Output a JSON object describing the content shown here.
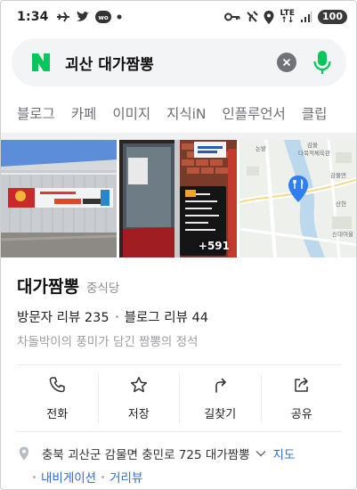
{
  "status_bar": {
    "time": "1:34",
    "left_icons": [
      "airplane-icon",
      "twitter-icon",
      "wo-app-icon",
      "notification-dot-icon"
    ],
    "right_icons": [
      "key-icon",
      "wifi-calling-icon",
      "location-icon",
      "lte-icon",
      "signal-icon"
    ],
    "lte_top": "LTE",
    "lte_bottom": "↑↓",
    "battery": "100"
  },
  "search": {
    "query": "괴산 대가짬뽕",
    "brand_color": "#03c75a"
  },
  "tabs": [
    "블로그",
    "카페",
    "이미지",
    "지식iN",
    "인플루언서",
    "클립"
  ],
  "photos": {
    "more_count": "+591"
  },
  "place": {
    "name": "대가짬뽕",
    "category": "중식당",
    "visitor_reviews_label": "방문자 리뷰",
    "visitor_reviews_count": "235",
    "blog_reviews_label": "블로그 리뷰",
    "blog_reviews_count": "44",
    "tagline": "차돌박이의 풍미가 담긴 짬뽕의 정석"
  },
  "actions": [
    {
      "label": "전화",
      "icon": "phone-icon"
    },
    {
      "label": "저장",
      "icon": "star-icon"
    },
    {
      "label": "길찾기",
      "icon": "directions-icon"
    },
    {
      "label": "공유",
      "icon": "share-icon"
    }
  ],
  "address": {
    "text": "충북 괴산군 감물면 충민로 725 대가짬뽕",
    "map_link": "지도",
    "navigation_link": "내비게이션",
    "street_view_link": "거리뷰"
  }
}
